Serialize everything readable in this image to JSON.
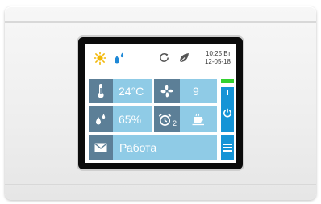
{
  "status": {
    "weather_icon": "sun-icon",
    "humidity_icon": "water-drops-icon",
    "mode_icon": "refresh-icon",
    "eco_icon": "leaf-icon",
    "time": "10:25 Вт",
    "date": "12-05-18"
  },
  "tiles": {
    "temperature": {
      "icon": "thermometer-icon",
      "value": "24°C"
    },
    "fan": {
      "icon": "fan-icon",
      "value": "9"
    },
    "humidity": {
      "icon": "water-drops-icon",
      "value": "65%"
    },
    "alarm": {
      "icon": "alarm-clock-icon",
      "subscript": "2",
      "extra_icon": "coffee-cup-icon"
    },
    "mode": {
      "icon": "envelope-icon",
      "value": "Работа"
    }
  },
  "controls": {
    "level_indicator": {
      "color": "#33d12f"
    },
    "power_icon": "power-icon",
    "menu_icon": "menu-icon"
  },
  "colors": {
    "tile_bg": "#8fcbe6",
    "tile_icon_bg": "#5c7f97",
    "accent": "#1594d6"
  }
}
